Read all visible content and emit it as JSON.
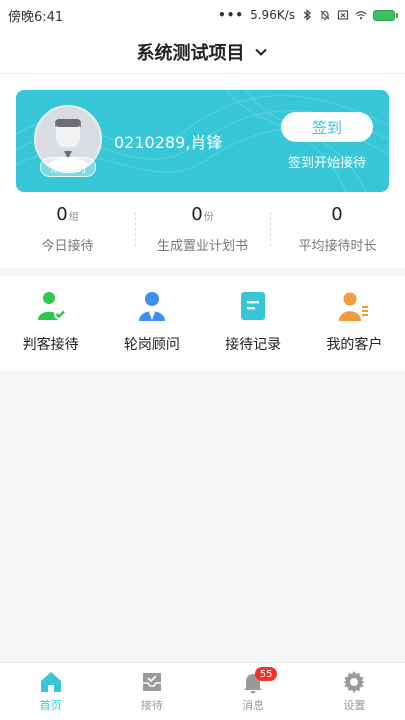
{
  "status_bar": {
    "time": "傍晚6:41",
    "network_speed": "5.96K/s"
  },
  "header": {
    "title": "系统测试项目"
  },
  "user_card": {
    "status_badge": "未签到",
    "user_name": "0210289,肖锋",
    "checkin_button": "签到",
    "checkin_hint": "签到开始接待"
  },
  "stats": [
    {
      "value": "0",
      "unit": "组",
      "label": "今日接待"
    },
    {
      "value": "0",
      "unit": "份",
      "label": "生成置业计划书"
    },
    {
      "value": "0",
      "unit": "",
      "label": "平均接待时长"
    }
  ],
  "quick_actions": [
    {
      "label": "判客接待",
      "icon": "person-check-icon",
      "color": "#2ec74e"
    },
    {
      "label": "轮岗顾问",
      "icon": "advisor-icon",
      "color": "#3d8ef2"
    },
    {
      "label": "接待记录",
      "icon": "document-icon",
      "color": "#38c7d7"
    },
    {
      "label": "我的客户",
      "icon": "customers-icon",
      "color": "#f39a3c"
    }
  ],
  "tab_bar": {
    "tabs": [
      {
        "label": "首页",
        "icon": "home-icon",
        "active": true
      },
      {
        "label": "接待",
        "icon": "inbox-icon"
      },
      {
        "label": "消息",
        "icon": "bell-icon",
        "badge": "55"
      },
      {
        "label": "设置",
        "icon": "gear-icon"
      }
    ]
  },
  "colors": {
    "accent": "#38c7d7",
    "badge": "#f0342b",
    "inactive": "#9a9a9a"
  }
}
